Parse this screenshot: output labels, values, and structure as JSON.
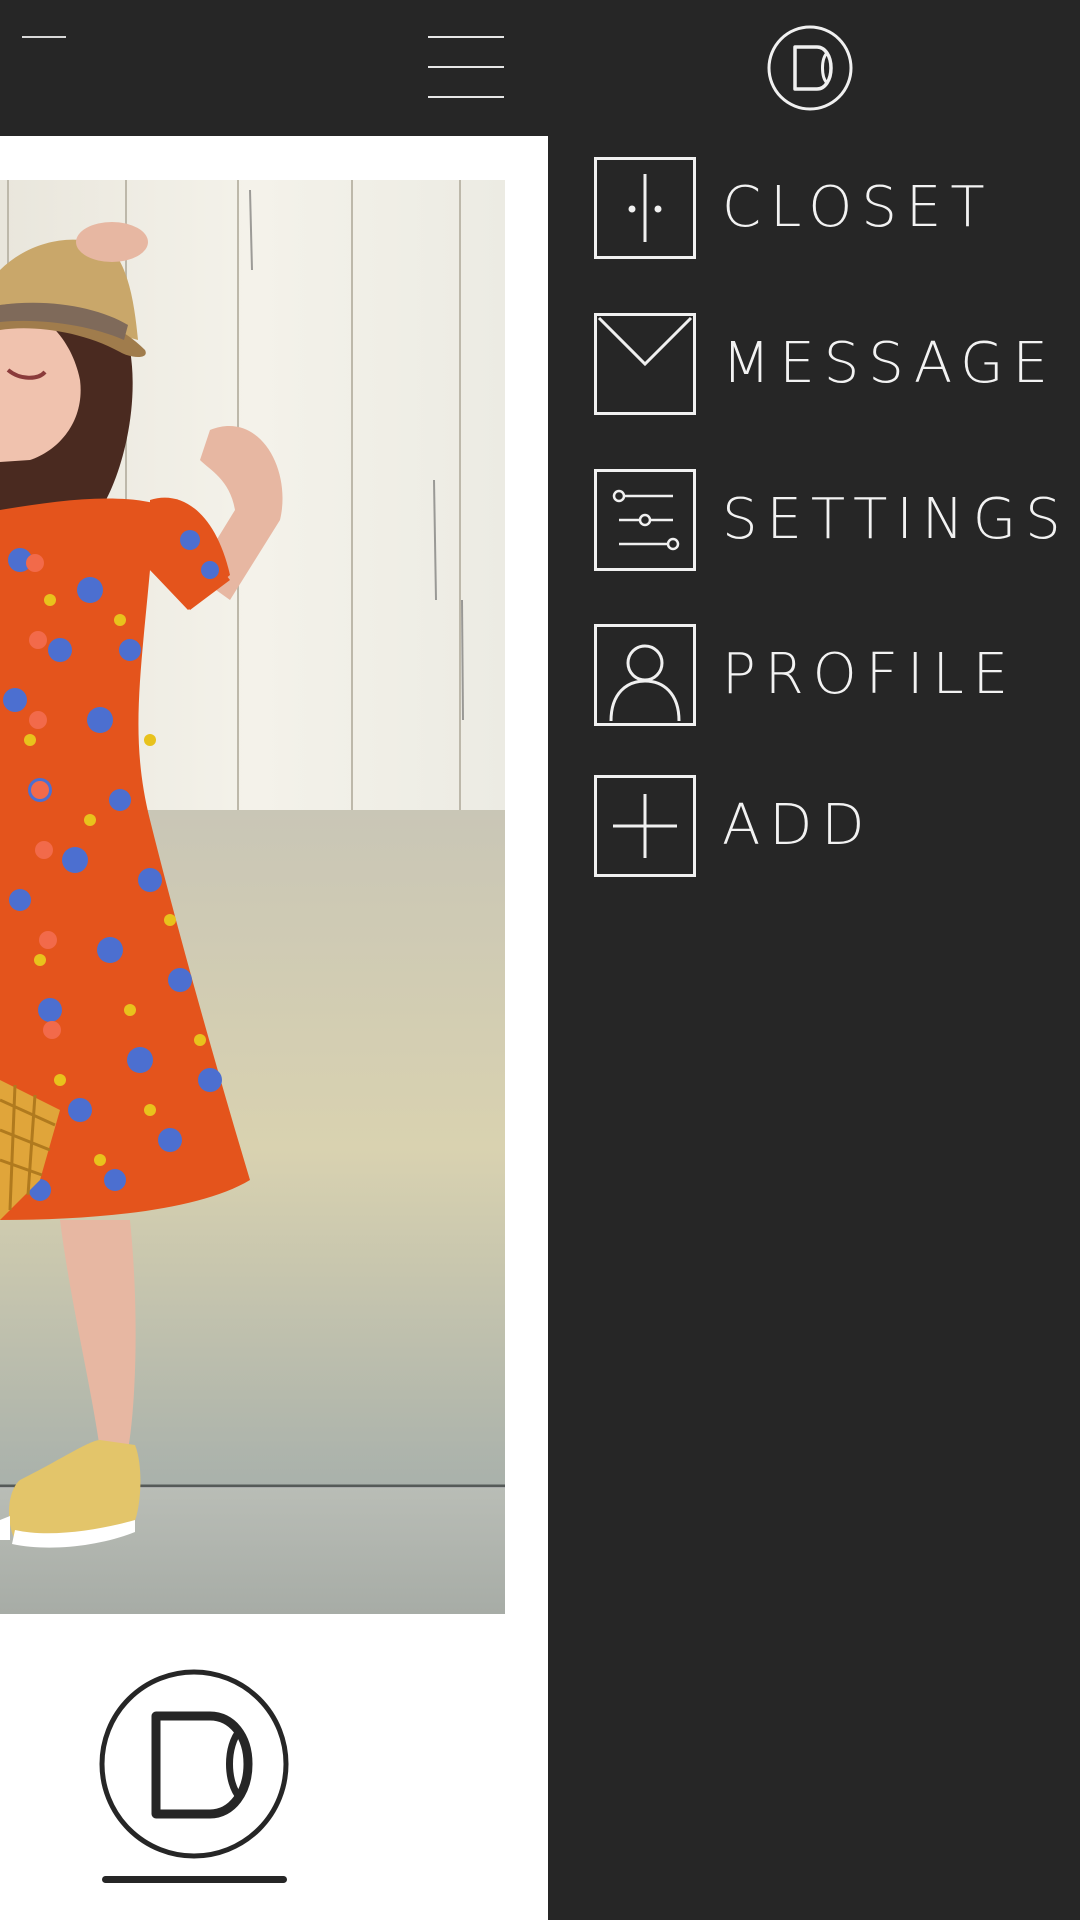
{
  "colors": {
    "background": "#262626",
    "panel": "#ffffff",
    "text": "#f2f2f2"
  },
  "header": {
    "back_icon": "minus-icon",
    "menu_icon": "hamburger-icon",
    "logo_icon": "d-logo-icon"
  },
  "menu": {
    "items": [
      {
        "label": "CLOSET",
        "icon": "closet-icon"
      },
      {
        "label": "MESSAGE",
        "icon": "envelope-icon"
      },
      {
        "label": "SETTINGS",
        "icon": "sliders-icon"
      },
      {
        "label": "PROFILE",
        "icon": "user-icon"
      },
      {
        "label": "ADD",
        "icon": "plus-icon"
      }
    ]
  },
  "content": {
    "photo": "woman-in-orange-floral-dress",
    "footer_logo_icon": "d-logo-icon"
  }
}
